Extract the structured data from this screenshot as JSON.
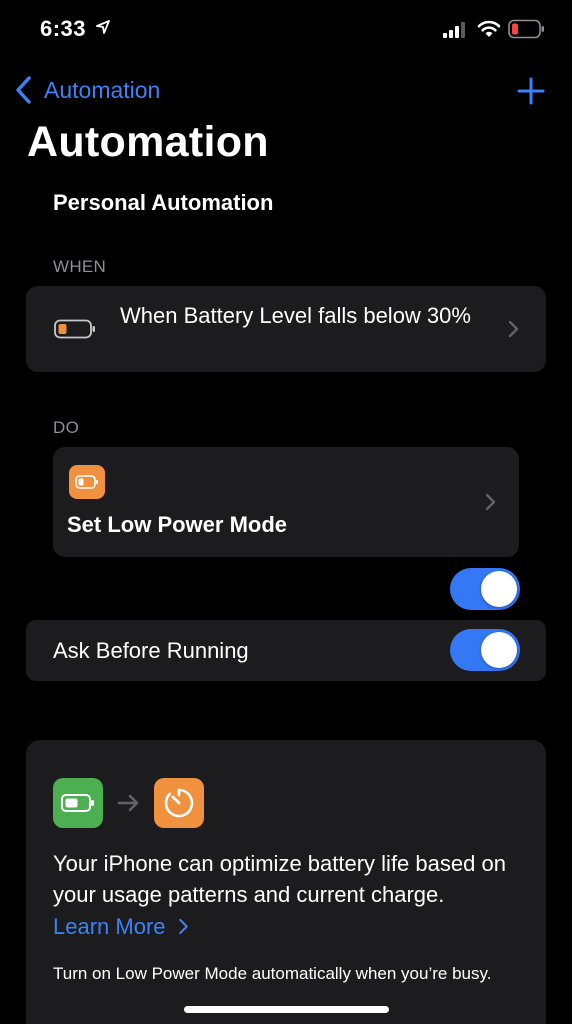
{
  "status_bar": {
    "time": "6:33",
    "location_icon": "location-arrow-icon",
    "signal_icon": "cellular-signal-icon",
    "wifi_icon": "wifi-icon",
    "battery_icon": "battery-low-icon",
    "battery_color": "#ff453a"
  },
  "nav": {
    "back_label": "Automation",
    "back_icon": "chevron-left-icon",
    "add_icon": "plus-icon"
  },
  "page": {
    "title": "Automation",
    "section_heading": "Personal Automation"
  },
  "when": {
    "label": "WHEN",
    "trigger_text": "When Battery Level falls below 30%",
    "trigger_icon": "battery-low-icon"
  },
  "do": {
    "label": "DO",
    "action_title": "Set Low Power Mode",
    "action_icon": "battery-icon",
    "action_color": "#f0913f",
    "action_toggle_on": true
  },
  "ask_before_running": {
    "label": "Ask Before Running",
    "on": true
  },
  "suggestion": {
    "from_icon": "battery-icon",
    "to_icon": "timer-icon",
    "body": "Your iPhone can optimize battery life based on your usage patterns and current charge.",
    "learn_more": "Learn More",
    "subtext": "Turn on Low Power Mode automatically when you’re busy."
  },
  "colors": {
    "accent": "#3b82f6",
    "toggle_on": "#3478f6",
    "card_bg": "#1c1c1e",
    "secondary_text": "#8e8e93"
  }
}
